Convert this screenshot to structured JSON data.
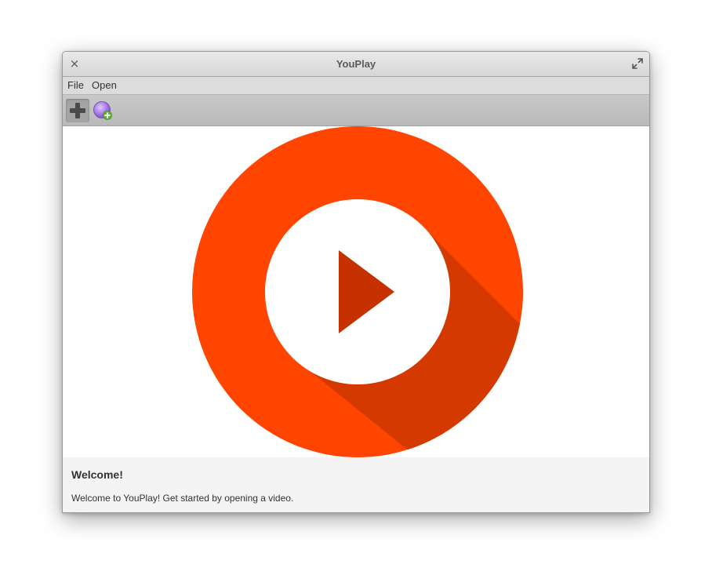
{
  "window": {
    "title": "YouPlay",
    "close_glyph": "×",
    "close_icon": "close-icon",
    "maximize_icon": "maximize-icon"
  },
  "menu": {
    "items": [
      {
        "label": "File"
      },
      {
        "label": "Open"
      }
    ]
  },
  "toolbar": {
    "buttons": [
      {
        "icon": "add-icon",
        "state": "active"
      },
      {
        "icon": "add-disc-icon",
        "state": "normal"
      }
    ]
  },
  "main": {
    "logo_icon": "youplay-logo-play-icon",
    "colors": {
      "ring": "#ff4500",
      "shadow": "#d43a00",
      "play": "#c63100"
    }
  },
  "welcome": {
    "title": "Welcome!",
    "text": "Welcome to YouPlay! Get started by opening a video."
  }
}
